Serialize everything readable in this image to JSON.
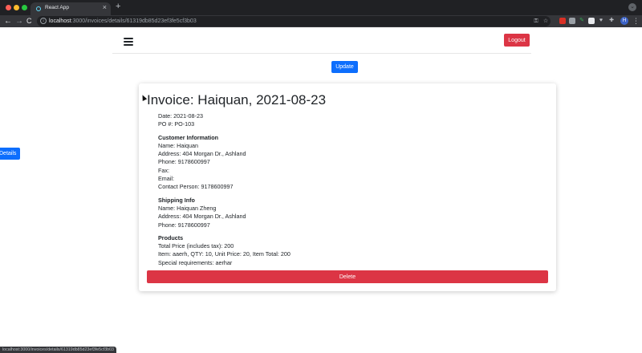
{
  "browser": {
    "tab_title": "React App",
    "tab_close": "×",
    "new_tab": "+",
    "url_host": "localhost",
    "url_path": ":3000/invoices/details/61319db85d23ef3fe5cf3b03",
    "avatar_letter": "H",
    "nav": {
      "back": "←",
      "forward": "→",
      "reload": "C"
    },
    "status_url": "localhost:3000/invoices/details/61319db85d23ef3fe5cf3b03"
  },
  "navbar": {
    "logout_label": "Logout"
  },
  "actions": {
    "update_label": "Update",
    "details_label": "Details",
    "delete_label": "Delete"
  },
  "invoice": {
    "title": "Invoice: Haiquan, 2021-08-23",
    "date": "Date: 2021-08-23",
    "po": "PO #: PO-103",
    "customer": {
      "heading": "Customer Information",
      "name": "Name: Haiquan",
      "address": "Address: 404 Morgan Dr., Ashland",
      "phone": "Phone: 9178600997",
      "fax": "Fax:",
      "email": "Email:",
      "contact": "Contact Person: 9178600997"
    },
    "shipping": {
      "heading": "Shipping Info",
      "name": "Name: Haiquan Zheng",
      "address": "Address: 404 Morgan Dr., Ashland",
      "phone": "Phone: 9178600997"
    },
    "products": {
      "heading": "Products",
      "total": "Total Price (includes tax): 200",
      "item": "Item: aaerh, QTY: 10, Unit Price: 20, Item Total: 200",
      "requirements": "Special requirements: aerhar"
    }
  },
  "colors": {
    "primary": "#0d6efd",
    "danger": "#dc3545",
    "chrome_dark": "#202124",
    "chrome_toolbar": "#35363a"
  }
}
